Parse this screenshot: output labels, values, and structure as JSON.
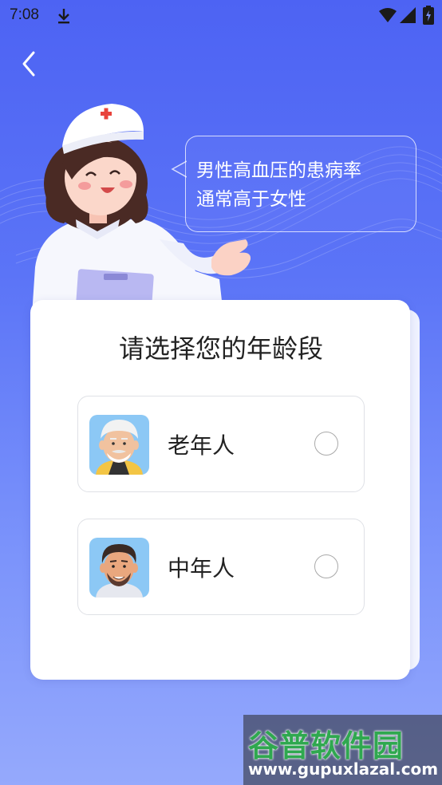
{
  "status_bar": {
    "time": "7:08",
    "icons": [
      "download-icon",
      "wifi-icon",
      "signal-icon",
      "battery-icon"
    ]
  },
  "nav": {
    "back_icon": "chevron-left-icon"
  },
  "bubble": {
    "text": "男性高血压的患病率\n通常高于女性"
  },
  "card": {
    "title": "请选择您的年龄段",
    "options": [
      {
        "label": "老年人",
        "avatar": "elderly-man-avatar",
        "selected": false
      },
      {
        "label": "中年人",
        "avatar": "middle-aged-man-avatar",
        "selected": false
      }
    ]
  },
  "watermark": {
    "brand": "谷普软件园",
    "url": "www.gupuxlazal.com"
  },
  "colors": {
    "background_top": "#4d63f3",
    "background_bottom": "#95a9fc",
    "card": "#ffffff",
    "radio_border": "#a9a9a9",
    "watermark_green": "#2fa84f"
  }
}
